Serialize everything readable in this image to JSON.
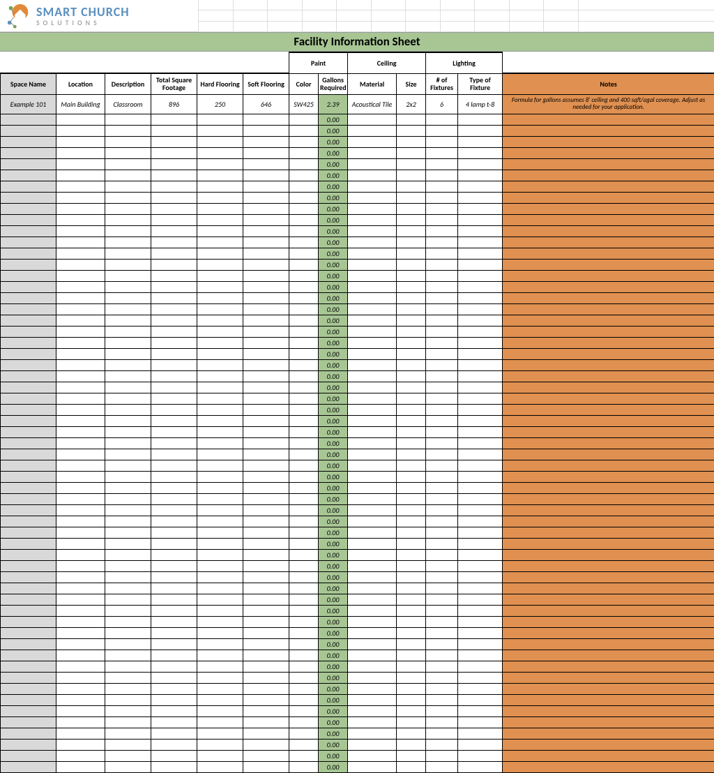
{
  "logo": {
    "top": "SMART CHURCH",
    "bottom": "SOLUTIONS"
  },
  "title": "Facility Information Sheet",
  "groupHeaders": {
    "paint": "Paint",
    "ceiling": "Ceiling",
    "lighting": "Lighting"
  },
  "columns": {
    "space": "Space Name",
    "location": "Location",
    "description": "Description",
    "sqft": "Total Square Footage",
    "hard": "Hard Flooring",
    "soft": "Soft Flooring",
    "color": "Color",
    "gallons": "Gallons Required",
    "material": "Material",
    "size": "Size",
    "fixtures": "# of Fixtures",
    "fixtureType": "Type of Fixture",
    "notes": "Notes"
  },
  "exampleRow": {
    "space": "Example 101",
    "location": "Main Building",
    "description": "Classroom",
    "sqft": "896",
    "hard": "250",
    "soft": "646",
    "color": "SW425",
    "gallons": "2.39",
    "material": "Acoustical Tile",
    "size": "2x2",
    "fixtures": "6",
    "fixtureType": "4 lamp t-8",
    "notes": "Formula for gallons assumes 8' ceiling and 400 sqft/agal coverage. Adjust as needed for your application."
  },
  "emptyGallons": "0.00",
  "emptyRowCount": 59,
  "colors": {
    "greenBar": "#a7c694",
    "grayCol": "#d9d9d9",
    "orangeCol": "#e09050"
  }
}
